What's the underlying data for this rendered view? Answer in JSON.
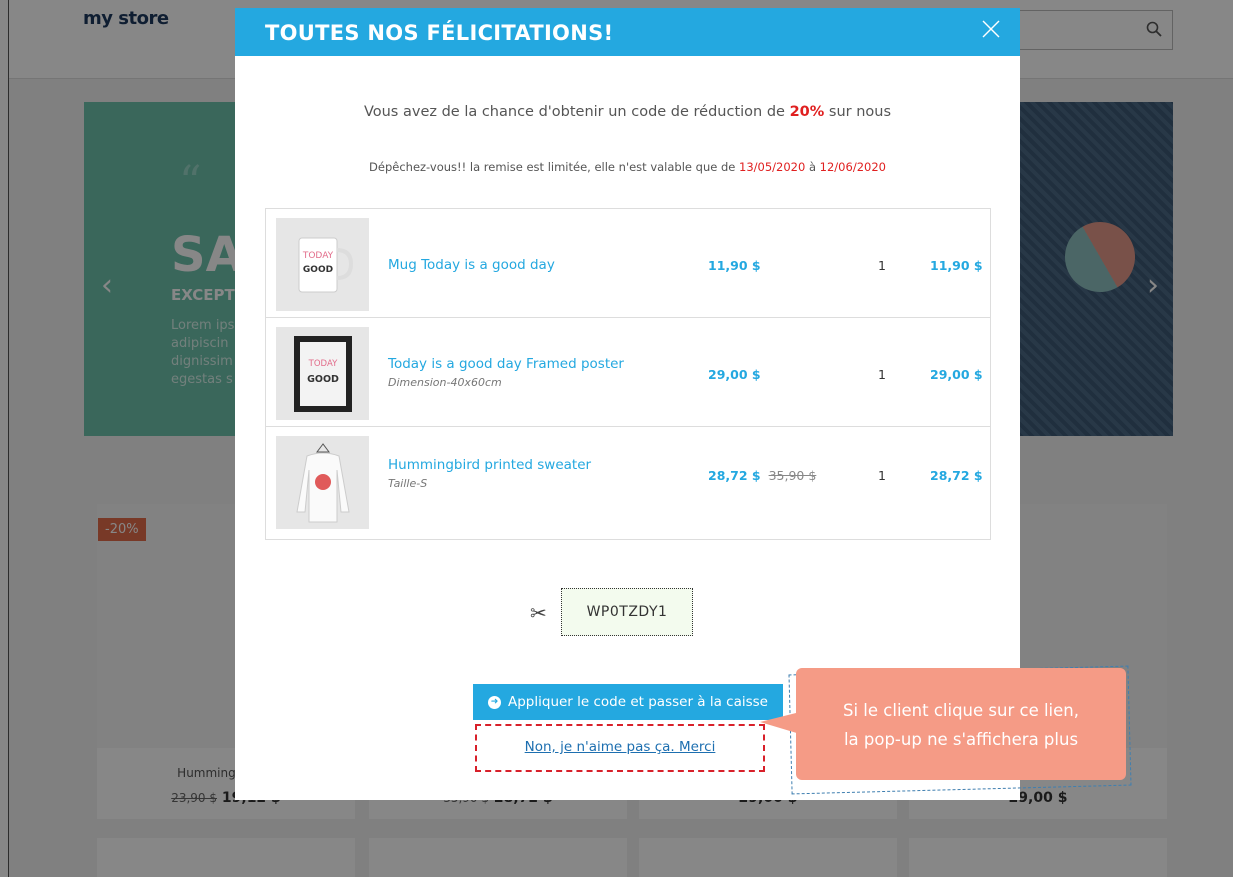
{
  "store": {
    "logo": "my store",
    "hero": {
      "quote_mark": "“",
      "heading": "SA",
      "subheading": "EXCEPT",
      "body": "Lorem ips adipiscin dignissim egestas s"
    },
    "products": [
      {
        "name": "Hummingbird Pr",
        "old_price": "23,90 $",
        "price": "19,12 $",
        "badge": "-20%"
      },
      {
        "name": "",
        "old_price": "35,90 $",
        "price": "28,72 $"
      },
      {
        "name": "",
        "old_price": "",
        "price": "29,00 $"
      },
      {
        "name": "",
        "old_price": "",
        "price": "29,00 $"
      }
    ]
  },
  "modal": {
    "title": "TOUTES NOS FÉLICITATIONS!",
    "close_label": "×",
    "lead_pre": "Vous avez de la chance d'obtenir un code de réduction de ",
    "discount": "20%",
    "lead_post": " sur nous",
    "sub_pre": "Dépêchez-vous!! la remise est limitée, elle n'est valable que de ",
    "date_from": "13/05/2020",
    "sub_mid": " à ",
    "date_to": "12/06/2020",
    "items": [
      {
        "name": "Mug Today is a good day",
        "attribute": "",
        "price": "11,90 $",
        "old_price": "",
        "qty": "1",
        "total": "11,90 $",
        "thumb_text": "TODAY GOOD"
      },
      {
        "name": "Today is a good day Framed poster",
        "attribute": "Dimension-40x60cm",
        "price": "29,00 $",
        "old_price": "",
        "qty": "1",
        "total": "29,00 $",
        "thumb_text": "TODAY GOOD"
      },
      {
        "name": "Hummingbird printed sweater",
        "attribute": "Taille-S",
        "price": "28,72 $",
        "old_price": "35,90 $",
        "qty": "1",
        "total": "28,72 $",
        "thumb_text": ""
      }
    ],
    "coupon_code": "WP0TZDY1",
    "apply_button": "Appliquer le code et passer à la caisse",
    "decline_link": "Non, je n'aime pas ça. Merci"
  },
  "callout": {
    "line1": "Si le client clique sur ce lien,",
    "line2": "la pop-up ne s'affichera plus"
  },
  "colors": {
    "accent": "#24a8e0",
    "highlight": "#e02020",
    "callout": "#f59b86",
    "hero": "#6fc2ad"
  }
}
